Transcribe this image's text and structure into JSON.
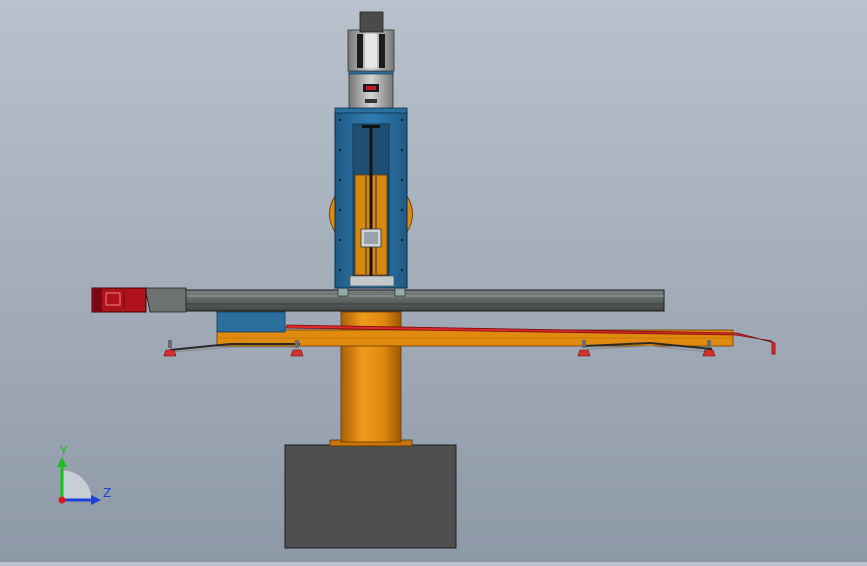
{
  "viewport": {
    "background_top": "#b9c1cc",
    "background_bottom": "#8e99a8"
  },
  "triad": {
    "y_label": "Y",
    "z_label": "Z",
    "y_color": "#1bbf1b",
    "z_color": "#1c3fd6",
    "x_color": "#d81c1c"
  },
  "colors": {
    "column": "#e08a10",
    "frame_blue": "#2a6f9e",
    "base_block": "#4f4f4f",
    "rail": "#5e6461",
    "motor_red": "#b0121c",
    "arm_red": "#e02a2a"
  }
}
